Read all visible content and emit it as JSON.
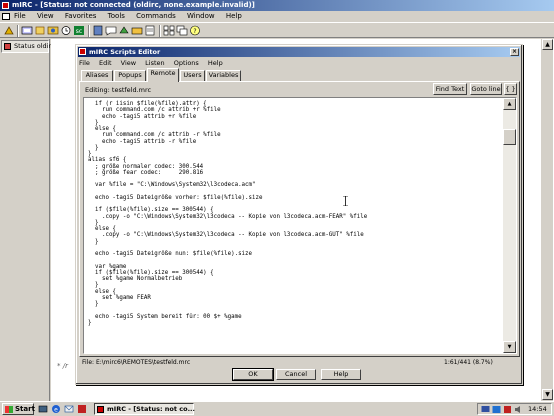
{
  "app": {
    "title": "mIRC - [Status: not connected (oldirc, none.example.invalid)]",
    "menu": [
      "File",
      "View",
      "Favorites",
      "Tools",
      "Commands",
      "Window",
      "Help"
    ]
  },
  "switchbar": {
    "items": [
      {
        "label": "Status oldirc"
      }
    ]
  },
  "background_window": {
    "fragment": "* /r"
  },
  "editor_dialog": {
    "title": "mIRC Scripts Editor",
    "close_glyph": "×",
    "menu": [
      "File",
      "Edit",
      "View",
      "Listen",
      "Options",
      "Help"
    ],
    "tabs": [
      {
        "label": "Aliases",
        "active": false
      },
      {
        "label": "Popups",
        "active": false
      },
      {
        "label": "Remote",
        "active": true
      },
      {
        "label": "Users",
        "active": false
      },
      {
        "label": "Variables",
        "active": false
      }
    ],
    "editing_label": "Editing: testfeld.mrc",
    "find_text_label": "Find Text",
    "goto_line_label": "Goto line",
    "braces_label": "{ }",
    "code_lines": [
      "  if (r iisin $file(%file).attr) {",
      "    run command.com /c attrib +r %file",
      "    echo -tagi5 attrib +r %file",
      "  }",
      "  else {",
      "    run command.com /c attrib -r %file",
      "    echo -tagi5 attrib -r %file",
      "  }",
      "}",
      "alias sf6 {",
      "  ; größe normaler codec: 300.544",
      "  ; größe fear codec:     290.816",
      "",
      "  var %file = \"C:\\Windows\\System32\\l3codeca.acm\"",
      "",
      "  echo -tagi5 Dateigröße vorher: $file(%file).size",
      "",
      "  if ($file(%file).size == 300544) {",
      "    .copy -o \"C:\\Windows\\System32\\l3codeca -- Kopie von l3codeca.acm-FEAR\" %file",
      "  }",
      "  else {",
      "    .copy -o \"C:\\Windows\\System32\\l3codeca -- Kopie von l3codeca.acm-GUT\" %file",
      "  }",
      "",
      "  echo -tagi5 Dateigröße nun: $file(%file).size",
      "",
      "  var %game",
      "  if ($file(%file).size == 300544) {",
      "    set %game Normalbetrieb",
      "  }",
      "  else {",
      "    set %game FEAR",
      "  }",
      "",
      "  echo -tagi5 System bereit für: 00 $+ %game",
      "}"
    ],
    "status_file": "File: E:\\mirc6\\REMOTES\\testfeld.mrc",
    "status_position": "1:61/441 (8.7%)",
    "buttons": {
      "ok": "OK",
      "cancel": "Cancel",
      "help": "Help"
    },
    "scroll_position": 0.087
  },
  "taskbar": {
    "start_label": "Start",
    "task_label": "mIRC - [Status: not co...",
    "clock": "14:54"
  },
  "colors": {
    "title_gradient_start": "#0a246a",
    "title_gradient_end": "#a6caf0",
    "face": "#d4d0c8"
  }
}
